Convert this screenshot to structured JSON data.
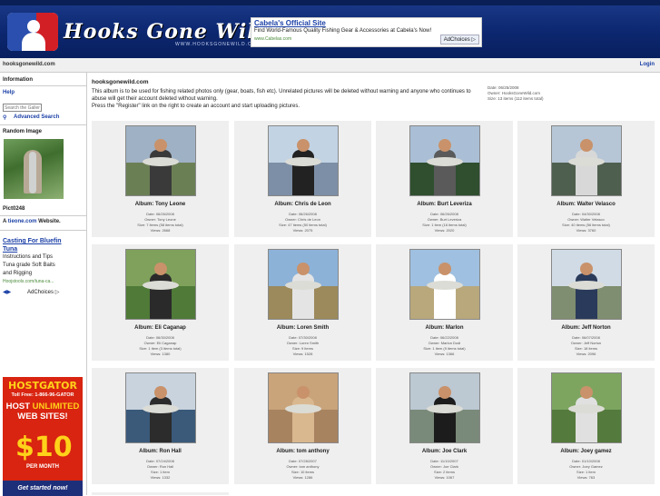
{
  "header": {
    "logo_text": "Hooks Gone Wild",
    "logo_subtitle": "WWW.HOOKSGONEWILD.COM"
  },
  "top_ad": {
    "title": "Cabela's Official Site",
    "description": "Find World-Famous Quality Fishing Gear & Accessories at Cabela's Now!",
    "url": "www.Cabelas.com",
    "adchoices": "AdChoices"
  },
  "subbar": {
    "site": "hooksgonewild.com",
    "login": "Login"
  },
  "sidebar": {
    "information": "Information",
    "help": "Help",
    "search_placeholder": "Search the Gallery",
    "advanced_search": "Advanced Search",
    "random_image": "Random Image",
    "random_image_name": "Pict0248",
    "tieone_prefix": "A ",
    "tieone_link": "tieone.com",
    "tieone_suffix": " Website.",
    "ad_link": "Casting For Bluefin Tuna",
    "ad_lines": [
      "Instructions and Tips",
      "Tuna grade Soft Baits",
      "and Rigging"
    ],
    "ad_url": "Hoojstools.com/tuna-ca...",
    "adchoices": "AdChoices"
  },
  "left_ad": {
    "brand": "HOSTGATOR",
    "toll": "Toll Free: 1-866-96-GATOR",
    "line1": "HOST ",
    "line1b": "UNLIMITED",
    "line2": "WEB SITES!",
    "price": "$10",
    "per_month": "PER MONTH",
    "cta": "Get started now!"
  },
  "main": {
    "site_title": "hooksgonewild.com",
    "intro_line1": "This album is to be used for fishing related photos only (gear, boats, fish etc). Unrelated pictures will be deleted without warning and anyone who continues to abuse will get their account deleted without warning.",
    "intro_line2": "Press the \"Register\" link on the right to create an account and start uploading pictures.",
    "meta_date": "Date: 06/25/2008",
    "meta_owner": "Owner: HooksGoneWild.com",
    "meta_size": "Size: 13 items (112 items total)"
  },
  "albums": [
    {
      "name": "Album: Tony Leone",
      "date": "Date: 06/26/2008",
      "owner": "Owner: Tony Leone",
      "size": "Size: 7 items (58 items total)",
      "views": "Views: 2668"
    },
    {
      "name": "Album: Chris de Leon",
      "date": "Date: 06/26/2008",
      "owner": "Owner: Chris de Leon",
      "size": "Size: 47 items (50 items total)",
      "views": "Views: 2075"
    },
    {
      "name": "Album: Burt Leveriza",
      "date": "Date: 06/26/2008",
      "owner": "Owner: Burt Leveriza",
      "size": "Size: 1 item (16 items total)",
      "views": "Views: 2020"
    },
    {
      "name": "Album: Walter Velasco",
      "date": "Date: 04/30/2008",
      "owner": "Owner: Walter Velasco",
      "size": "Size: 40 items (56 items total)",
      "views": "Views: 3760"
    },
    {
      "name": "Album: Eli Caganap",
      "date": "Date: 06/30/2008",
      "owner": "Owner: Eli Caganap",
      "size": "Size: 1 item (3 items total)",
      "views": "Views: 1380"
    },
    {
      "name": "Album: Loren Smith",
      "date": "Date: 07/30/2008",
      "owner": "Owner: Loren Smith",
      "size": "Size: 9 items",
      "views": "Views: 1528"
    },
    {
      "name": "Album: Marlon",
      "date": "Date: 06/22/2008",
      "owner": "Owner: Marlon Dodi",
      "size": "Size: 1 item (9 items total)",
      "views": "Views: 1366"
    },
    {
      "name": "Album: Jeff Norton",
      "date": "Date: 06/07/2008",
      "owner": "Owner: Jeff Norton",
      "size": "Size: 18 items",
      "views": "Views: 2096"
    },
    {
      "name": "Album: Ron Hall",
      "date": "Date: 07/24/2008",
      "owner": "Owner: Ron Hall",
      "size": "Size: 1 item",
      "views": "Views: 1332"
    },
    {
      "name": "Album: tom anthony",
      "date": "Date: 07/28/2007",
      "owner": "Owner: tom anthony",
      "size": "Size: 10 items",
      "views": "Views: 1286"
    },
    {
      "name": "Album: Joe Clark",
      "date": "Date: 11/10/2007",
      "owner": "Owner: Joe Clark",
      "size": "Size: 2 items",
      "views": "Views: 1067"
    },
    {
      "name": "Album: Joey gamez",
      "date": "Date: 01/10/2008",
      "owner": "Owner: Joey Gamez",
      "size": "Size: 1 item",
      "views": "Views: 763"
    }
  ]
}
